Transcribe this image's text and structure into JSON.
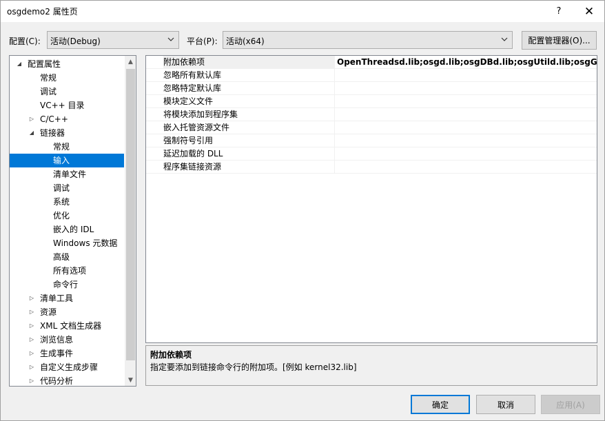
{
  "window": {
    "title": "osgdemo2 属性页",
    "help_label": "?",
    "close_label": "✕"
  },
  "toolbar": {
    "config_label": "配置(C):",
    "config_value": "活动(Debug)",
    "platform_label": "平台(P):",
    "platform_value": "活动(x64)",
    "config_manager_label": "配置管理器(O)..."
  },
  "tree": {
    "items": [
      {
        "label": "配置属性",
        "arrow": "◢",
        "level": 0
      },
      {
        "label": "常规",
        "arrow": "",
        "level": 1
      },
      {
        "label": "调试",
        "arrow": "",
        "level": 1
      },
      {
        "label": "VC++ 目录",
        "arrow": "",
        "level": 1
      },
      {
        "label": "C/C++",
        "arrow": "▷",
        "level": 1
      },
      {
        "label": "链接器",
        "arrow": "◢",
        "level": 1
      },
      {
        "label": "常规",
        "arrow": "",
        "level": 2
      },
      {
        "label": "输入",
        "arrow": "",
        "level": 2,
        "selected": true
      },
      {
        "label": "清单文件",
        "arrow": "",
        "level": 2
      },
      {
        "label": "调试",
        "arrow": "",
        "level": 2
      },
      {
        "label": "系统",
        "arrow": "",
        "level": 2
      },
      {
        "label": "优化",
        "arrow": "",
        "level": 2
      },
      {
        "label": "嵌入的 IDL",
        "arrow": "",
        "level": 2
      },
      {
        "label": "Windows 元数据",
        "arrow": "",
        "level": 2
      },
      {
        "label": "高级",
        "arrow": "",
        "level": 2
      },
      {
        "label": "所有选项",
        "arrow": "",
        "level": 2
      },
      {
        "label": "命令行",
        "arrow": "",
        "level": 2
      },
      {
        "label": "清单工具",
        "arrow": "▷",
        "level": 1
      },
      {
        "label": "资源",
        "arrow": "▷",
        "level": 1
      },
      {
        "label": "XML 文档生成器",
        "arrow": "▷",
        "level": 1
      },
      {
        "label": "浏览信息",
        "arrow": "▷",
        "level": 1
      },
      {
        "label": "生成事件",
        "arrow": "▷",
        "level": 1
      },
      {
        "label": "自定义生成步骤",
        "arrow": "▷",
        "level": 1
      },
      {
        "label": "代码分析",
        "arrow": "▷",
        "level": 1
      }
    ],
    "scroll_up": "▲",
    "scroll_down": "▼"
  },
  "properties": [
    {
      "name": "附加依赖项",
      "value": "OpenThreadsd.lib;osgd.lib;osgDBd.lib;osgUtild.lib;osgGAd.lib;osgViewerd.lib",
      "selected": true
    },
    {
      "name": "忽略所有默认库",
      "value": ""
    },
    {
      "name": "忽略特定默认库",
      "value": ""
    },
    {
      "name": "模块定义文件",
      "value": ""
    },
    {
      "name": "将模块添加到程序集",
      "value": ""
    },
    {
      "name": "嵌入托管资源文件",
      "value": ""
    },
    {
      "name": "强制符号引用",
      "value": ""
    },
    {
      "name": "延迟加载的 DLL",
      "value": ""
    },
    {
      "name": "程序集链接资源",
      "value": ""
    }
  ],
  "description": {
    "title": "附加依赖项",
    "text": "指定要添加到链接命令行的附加项。[例如 kernel32.lib]"
  },
  "buttons": {
    "ok": "确定",
    "cancel": "取消",
    "apply": "应用(A)"
  }
}
